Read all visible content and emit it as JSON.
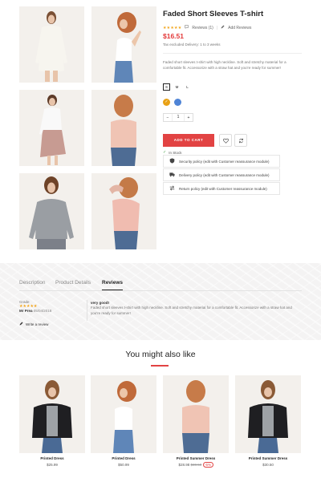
{
  "product": {
    "title": "Faded Short Sleeves T-shirt",
    "stars": "★★★★★",
    "reviews_link": "Reviews (1)",
    "add_review": "Add Reviews",
    "price": "$16.51",
    "tax_note": "Tax excluded Delivery: 1 to 3 weeks",
    "description": "Faded short sleeves t-shirt with high neckline. Soft and stretchy material for a comfortable fit. Accessorize with a straw hat and you're ready for summer!",
    "sizes": [
      "S",
      "M",
      "L"
    ],
    "selected_size": "S",
    "colors": [
      "#e8a116",
      "#4f84d6"
    ],
    "quantity": "1",
    "add_to_cart": "ADD TO CART",
    "stock_status": "In Stock",
    "policies": [
      "Security policy (edit with Customer reassurance module)",
      "Delivery policy (edit with Customer reassurance module)",
      "Return policy (edit with Customer reassurance module)"
    ]
  },
  "tabs": {
    "items": [
      "Description",
      "Product Details",
      "Reviews"
    ],
    "active": "Reviews"
  },
  "review": {
    "grade_label": "Grade",
    "stars": "★★★★★",
    "author": "Mr Prea",
    "date": "05/04/2018",
    "title": "very good!",
    "text": "Faded short sleeves t-shirt with high neckline. Soft and stretchy material for a comfortable fit. Accessorize with a straw hat and you're ready for summer!",
    "write_label": "Write a review"
  },
  "related": {
    "title": "You might also like",
    "products": [
      {
        "name": "Printed Dress",
        "price": "$25.99"
      },
      {
        "name": "Printed Dress",
        "price": "$50.99"
      },
      {
        "name": "Printed Summer Dress",
        "price": "$28.98",
        "old_price": "$30.50",
        "discount": "-5%"
      },
      {
        "name": "Printed Summer Dress",
        "price": "$30.50"
      }
    ]
  },
  "colors": {
    "accent": "#e24343",
    "star": "#f2a51a",
    "background": "#ffffff"
  }
}
